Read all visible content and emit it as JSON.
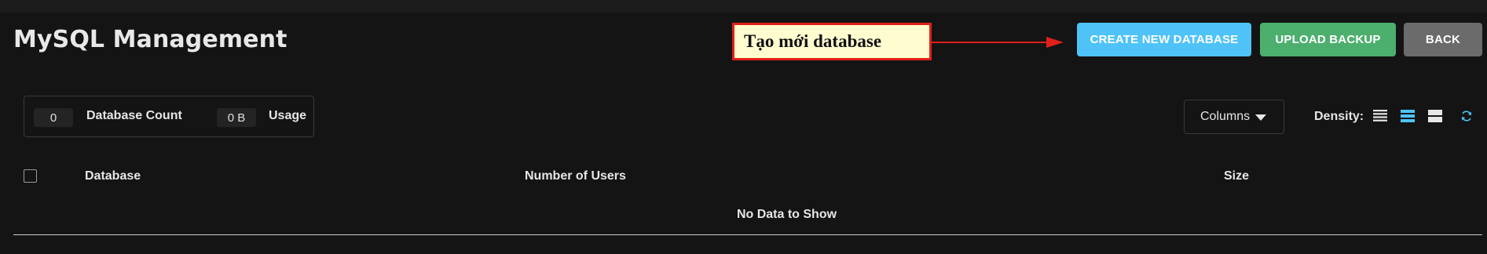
{
  "page": {
    "title": "MySQL Management"
  },
  "annotation": {
    "text": "Tạo mới database"
  },
  "toolbar": {
    "create_label": "CREATE NEW DATABASE",
    "upload_label": "UPLOAD BACKUP",
    "back_label": "BACK"
  },
  "stats": {
    "database_count_value": "0",
    "database_count_label": "Database Count",
    "usage_value": "0 B",
    "usage_label": "Usage"
  },
  "controls": {
    "columns_label": "Columns",
    "density_label": "Density:",
    "density_options": [
      "compact",
      "standard",
      "comfortable"
    ],
    "density_selected": "standard"
  },
  "table": {
    "headers": [
      "Database",
      "Number of Users",
      "Size"
    ],
    "empty_message": "No Data to Show"
  },
  "colors": {
    "background": "#141414",
    "create_button": "#4fc3f7",
    "upload_button": "#4caf6e",
    "back_button": "#6b6b6b",
    "accent": "#4fc3f7",
    "callout_border": "#e0201a",
    "callout_fill": "#fffdd0"
  }
}
